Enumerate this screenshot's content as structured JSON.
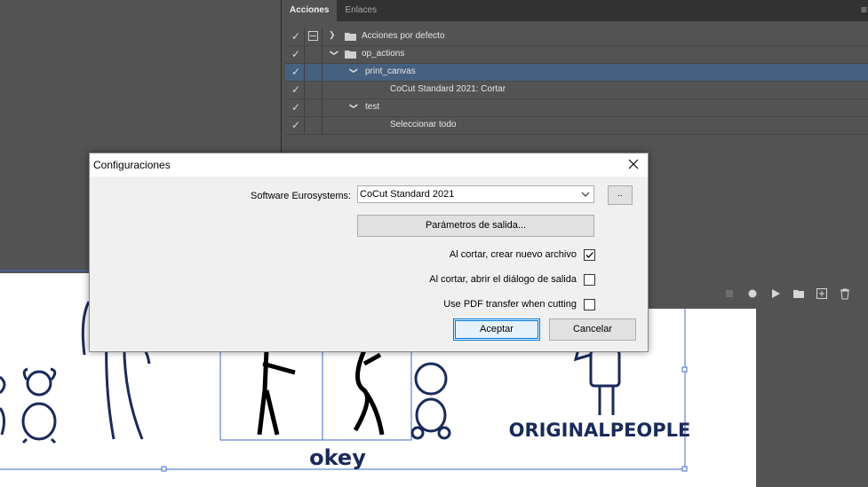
{
  "panel": {
    "tabs": [
      {
        "label": "Acciones",
        "active": true
      },
      {
        "label": "Enlaces",
        "active": false
      }
    ],
    "menu_icon": "hamburger-menu-icon",
    "actions": [
      {
        "label": "Acciones por defecto",
        "type": "set",
        "expanded": false,
        "checked": true,
        "has_dialog_toggle": true,
        "selected": false
      },
      {
        "label": "op_actions",
        "type": "set",
        "expanded": true,
        "checked": true,
        "has_dialog_toggle": false,
        "selected": false
      },
      {
        "label": "print_canvas",
        "type": "action",
        "expanded": true,
        "checked": true,
        "has_dialog_toggle": false,
        "selected": true
      },
      {
        "label": "CoCut Standard 2021: Cortar",
        "type": "step",
        "checked": true,
        "has_dialog_toggle": false,
        "selected": false
      },
      {
        "label": "test",
        "type": "action",
        "expanded": true,
        "checked": true,
        "has_dialog_toggle": false,
        "selected": false
      },
      {
        "label": "Seleccionar todo",
        "type": "step",
        "checked": true,
        "has_dialog_toggle": false,
        "selected": false
      }
    ],
    "bottom_icons": [
      "stop-icon",
      "record-icon",
      "play-icon",
      "new-set-icon",
      "new-action-icon",
      "delete-icon"
    ]
  },
  "dialog": {
    "title": "Configuraciones",
    "software_label": "Software Eurosystems:",
    "software_value": "CoCut Standard 2021",
    "browse_label": "..",
    "params_button": "Parámetros de salida...",
    "options": [
      {
        "label": "Al cortar, crear nuevo archivo",
        "checked": true
      },
      {
        "label": "Al cortar, abrir el diálogo de salida",
        "checked": false
      },
      {
        "label": "Use PDF transfer when cutting",
        "checked": false
      }
    ],
    "ok_button": "Aceptar",
    "cancel_button": "Cancelar"
  },
  "artwork": {
    "text_okey": "okey",
    "text_brand": "ORIGINALPEOPLE"
  },
  "colors": {
    "app_bg": "#535353",
    "selection": "#46607f",
    "art_stroke": "#1a2a5a",
    "accent_blue": "#0078d7"
  }
}
